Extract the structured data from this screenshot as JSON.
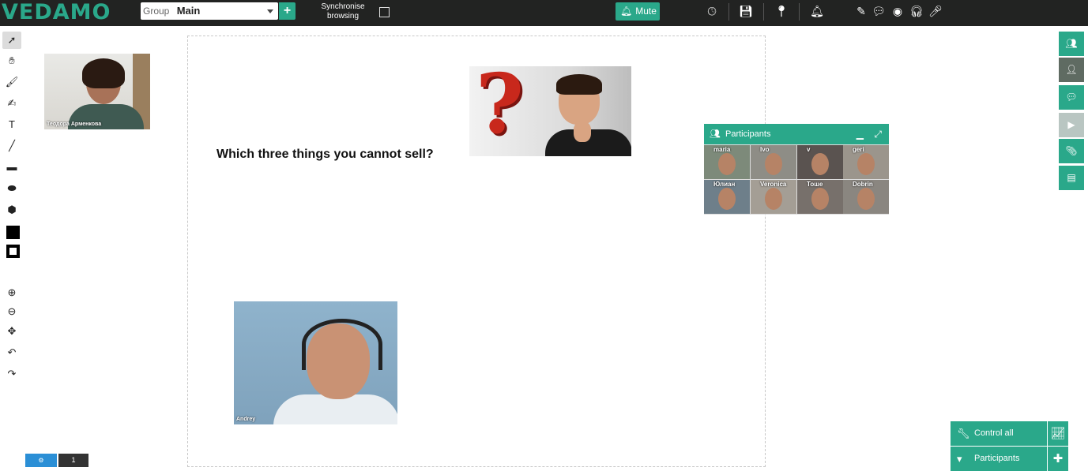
{
  "app": {
    "logo": "VEDAMO"
  },
  "header": {
    "group_label": "Group",
    "group_value": "Main",
    "add_group": "+",
    "sync_label": "Synchronise browsing",
    "mute_label": "Mute"
  },
  "board": {
    "question": "Which three things you cannot sell?"
  },
  "cams": {
    "teodora": "Теодора Арменкова",
    "andrey": "Andrey"
  },
  "participants_panel": {
    "title": "Participants",
    "tiles": [
      "maria",
      "Ivo",
      "v",
      "geri",
      "Юлиан",
      "Veronica",
      "Тоше",
      "Dobrin"
    ]
  },
  "controls": {
    "control_all": "Control all",
    "participants": "Participants"
  },
  "page_nav": {
    "page": "1"
  },
  "colors": {
    "accent": "#2aa88a",
    "topbar": "#222322",
    "page_nav_settings": "#2b8fd6"
  }
}
